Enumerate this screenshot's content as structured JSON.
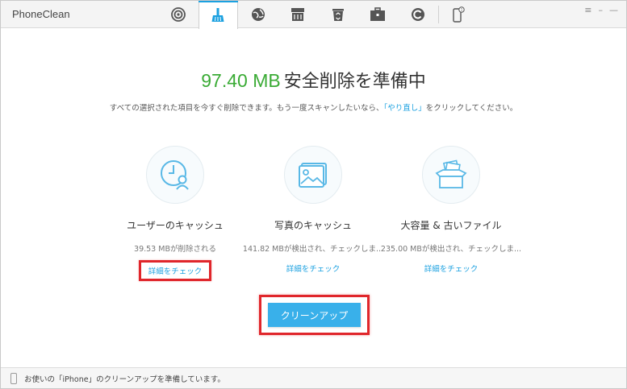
{
  "app": {
    "title": "PhoneClean"
  },
  "toolbar": {
    "tools": [
      {
        "icon": "radar-icon"
      },
      {
        "icon": "quick-clean-icon",
        "active": true
      },
      {
        "icon": "internet-clean-icon"
      },
      {
        "icon": "privacy-clean-icon"
      },
      {
        "icon": "system-clean-icon"
      },
      {
        "icon": "toolbox-icon"
      },
      {
        "icon": "silent-clean-icon"
      },
      {
        "icon": "device-icon"
      }
    ],
    "accent": "#1ca1e0"
  },
  "window_controls": {
    "menu": "≡",
    "minimize": "–",
    "close": "—"
  },
  "main": {
    "size": "97.40 MB",
    "heading": "安全削除を準備中",
    "sub_before": "すべての選択された項目を今すぐ削除できます。もう一度スキャンしたいなら、",
    "sub_link": "「やり直し」",
    "sub_after": "をクリックしてください。"
  },
  "cards": [
    {
      "title": "ユーザーのキャッシュ",
      "size_text": "39.53 MBが削除される",
      "link": "詳細をチェック",
      "icon": "user-cache-icon"
    },
    {
      "title": "写真のキャッシュ",
      "size_text": "141.82 MBが検出され、チェックしま...",
      "link": "詳細をチェック",
      "icon": "photo-cache-icon"
    },
    {
      "title": "大容量 & 古いファイル",
      "size_text": "235.00 MBが検出され、チェックしま...",
      "link": "詳細をチェック",
      "icon": "large-files-icon"
    }
  ],
  "cleanup_button": {
    "label": "クリーンアップ"
  },
  "status": {
    "text": "お使いの「iPhone」のクリーンアップを準備しています。"
  },
  "colors": {
    "accent_blue": "#1ca1e0",
    "size_green": "#3aab35",
    "highlight_red": "#e0262b",
    "button_blue": "#39b0ea"
  }
}
